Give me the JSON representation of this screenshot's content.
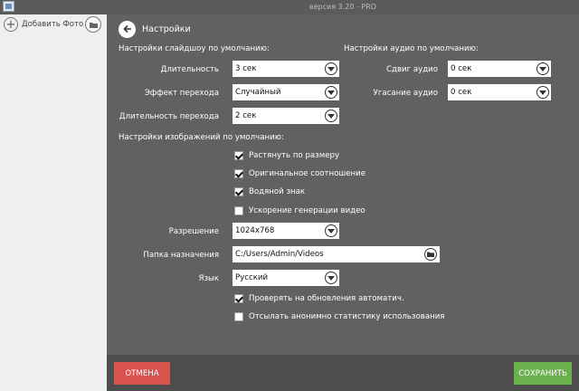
{
  "window": {
    "version": "версия 3.20 - PRO"
  },
  "sidebar": {
    "add_photo": "Добавить Фото",
    "add_icon": "+"
  },
  "header": {
    "title": "Настройки"
  },
  "slideshow": {
    "section": "Настройки слайдшоу по умолчанию:",
    "duration_label": "Длительность",
    "duration_value": "3 сек",
    "effect_label": "Эффект перехода",
    "effect_value": "Случайный",
    "transition_label": "Длительность перехода",
    "transition_value": "2 сек"
  },
  "audio": {
    "section": "Настройки аудио по умолчанию:",
    "shift_label": "Сдвиг аудио",
    "shift_value": "0 сек",
    "fade_label": "Угасание аудио",
    "fade_value": "0 сек"
  },
  "images": {
    "section": "Настройки изображений по умолчанию:",
    "options": [
      {
        "label": "Растянуть по размеру",
        "checked": true
      },
      {
        "label": "Оригинальное соотношение",
        "checked": true
      },
      {
        "label": "Водяной знак",
        "checked": true
      },
      {
        "label": "Ускорение генерации видео",
        "checked": false
      }
    ],
    "resolution_label": "Разрешение",
    "resolution_value": "1024x768",
    "dest_label": "Папка назначения",
    "dest_value": "C:/Users/Admin/Videos",
    "lang_label": "Язык",
    "lang_value": "Русский",
    "auto_update_label": "Проверять на обновления автоматич.",
    "auto_update_checked": true,
    "stats_label": "Отсылать анонимно статистику использования",
    "stats_checked": false
  },
  "footer": {
    "cancel": "ОТМЕНА",
    "save": "СОХРАНИТЬ"
  },
  "colors": {
    "cancel": "#d9534f",
    "save": "#6ab04c",
    "panel": "#616161"
  }
}
